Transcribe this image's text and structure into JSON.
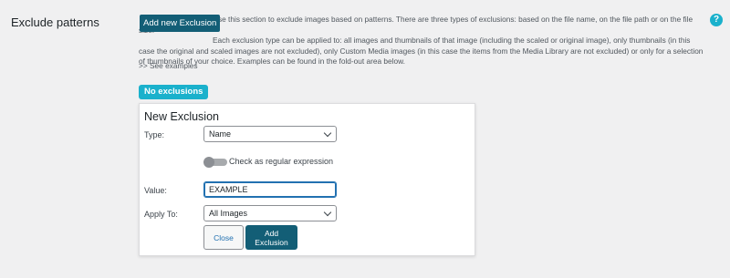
{
  "row": {
    "label": "Exclude patterns",
    "help_glyph": "?"
  },
  "header": {
    "add_new_label": "Add new Exclusion",
    "description_line1": "Use this section to exclude images based on patterns. There are three types of exclusions: based on the file name, on the file path or on the file size.",
    "description_line2": "Each exclusion type can be applied to: all images and thumbnails of that image (including the scaled or original image), only thumbnails (in this case the original and scaled images are not excluded), only Custom Media images (in this case the items from the Media Library are not excluded) or only for a selection of thumbnails of your choice. Examples can be found in the fold-out area below.",
    "see_examples": ">> See examples"
  },
  "badge": {
    "label": "No exclusions"
  },
  "form": {
    "title": "New Exclusion",
    "type_label": "Type:",
    "type_value": "Name",
    "regex_label": "Check as regular expression",
    "regex_on": false,
    "value_label": "Value:",
    "value_text": "EXAMPLE",
    "apply_label": "Apply To:",
    "apply_value": "All Images",
    "close_label": "Close",
    "submit_label": "Add Exclusion"
  },
  "colors": {
    "primary": "#135e76",
    "accent": "#1ab1cc",
    "background": "#f0f0f1"
  }
}
